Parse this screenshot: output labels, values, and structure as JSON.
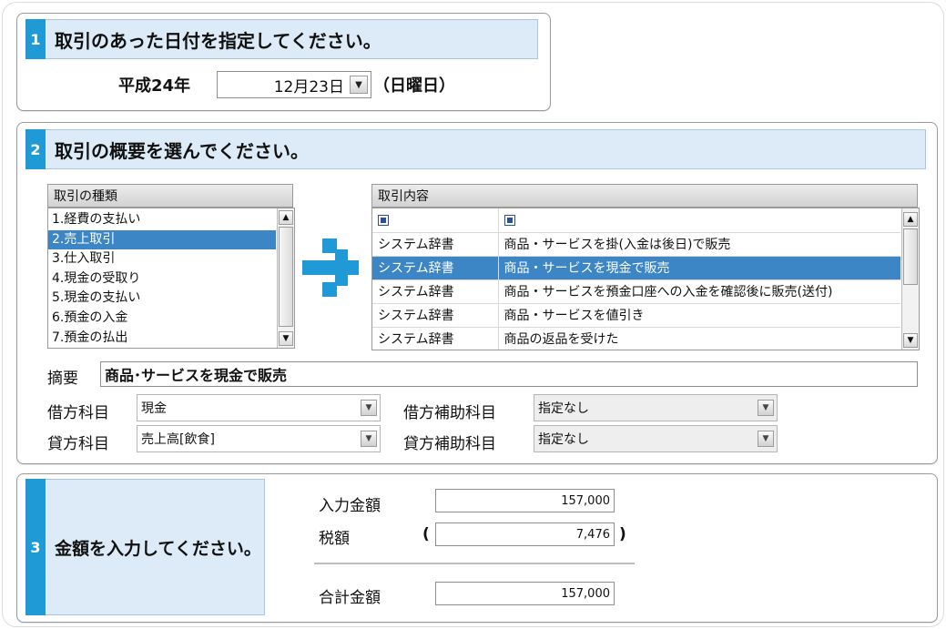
{
  "step1": {
    "number": "1",
    "title": "取引のあった日付を指定してください。",
    "era_year": "平成24年",
    "date_value": "12月23日",
    "weekday": "（日曜日）"
  },
  "step2": {
    "number": "2",
    "title": "取引の概要を選んでください。",
    "type_list": {
      "header": "取引の種類",
      "items": [
        "1.経費の支払い",
        "2.売上取引",
        "3.仕入取引",
        "4.現金の受取り",
        "5.現金の支払い",
        "6.預金の入金",
        "7.預金の払出"
      ],
      "selected_index": 1
    },
    "content_list": {
      "header": "取引内容",
      "rows": [
        {
          "source": "システム辞書",
          "content": "商品・サービスを掛(入金は後日)で販売"
        },
        {
          "source": "システム辞書",
          "content": "商品・サービスを現金で販売"
        },
        {
          "source": "システム辞書",
          "content": "商品・サービスを預金口座への入金を確認後に販売(送付)"
        },
        {
          "source": "システム辞書",
          "content": "商品・サービスを値引き"
        },
        {
          "source": "システム辞書",
          "content": "商品の返品を受けた"
        }
      ],
      "selected_index": 1
    },
    "summary_label": "摘要",
    "summary_value": "商品･サービスを現金で販売",
    "debit_label": "借方科目",
    "debit_value": "現金",
    "debit_sub_label": "借方補助科目",
    "debit_sub_value": "指定なし",
    "credit_label": "貸方科目",
    "credit_value": "売上高[飲食]",
    "credit_sub_label": "貸方補助科目",
    "credit_sub_value": "指定なし"
  },
  "step3": {
    "number": "3",
    "title": "金額を入力してください。",
    "input_amount_label": "入力金額",
    "input_amount_value": "157,000",
    "tax_label": "税額",
    "tax_open": "(",
    "tax_value": "7,476",
    "tax_close": ")",
    "total_label": "合計金額",
    "total_value": "157,000"
  },
  "colors": {
    "step_badge": "#1f9ad6",
    "step_title_bg": "#dcebf7",
    "selection": "#3d86c6",
    "arrow": "#1f9ad6"
  },
  "icons": {
    "flow_arrow": "arrow-right-icon",
    "dropdown": "chevron-down-icon"
  }
}
